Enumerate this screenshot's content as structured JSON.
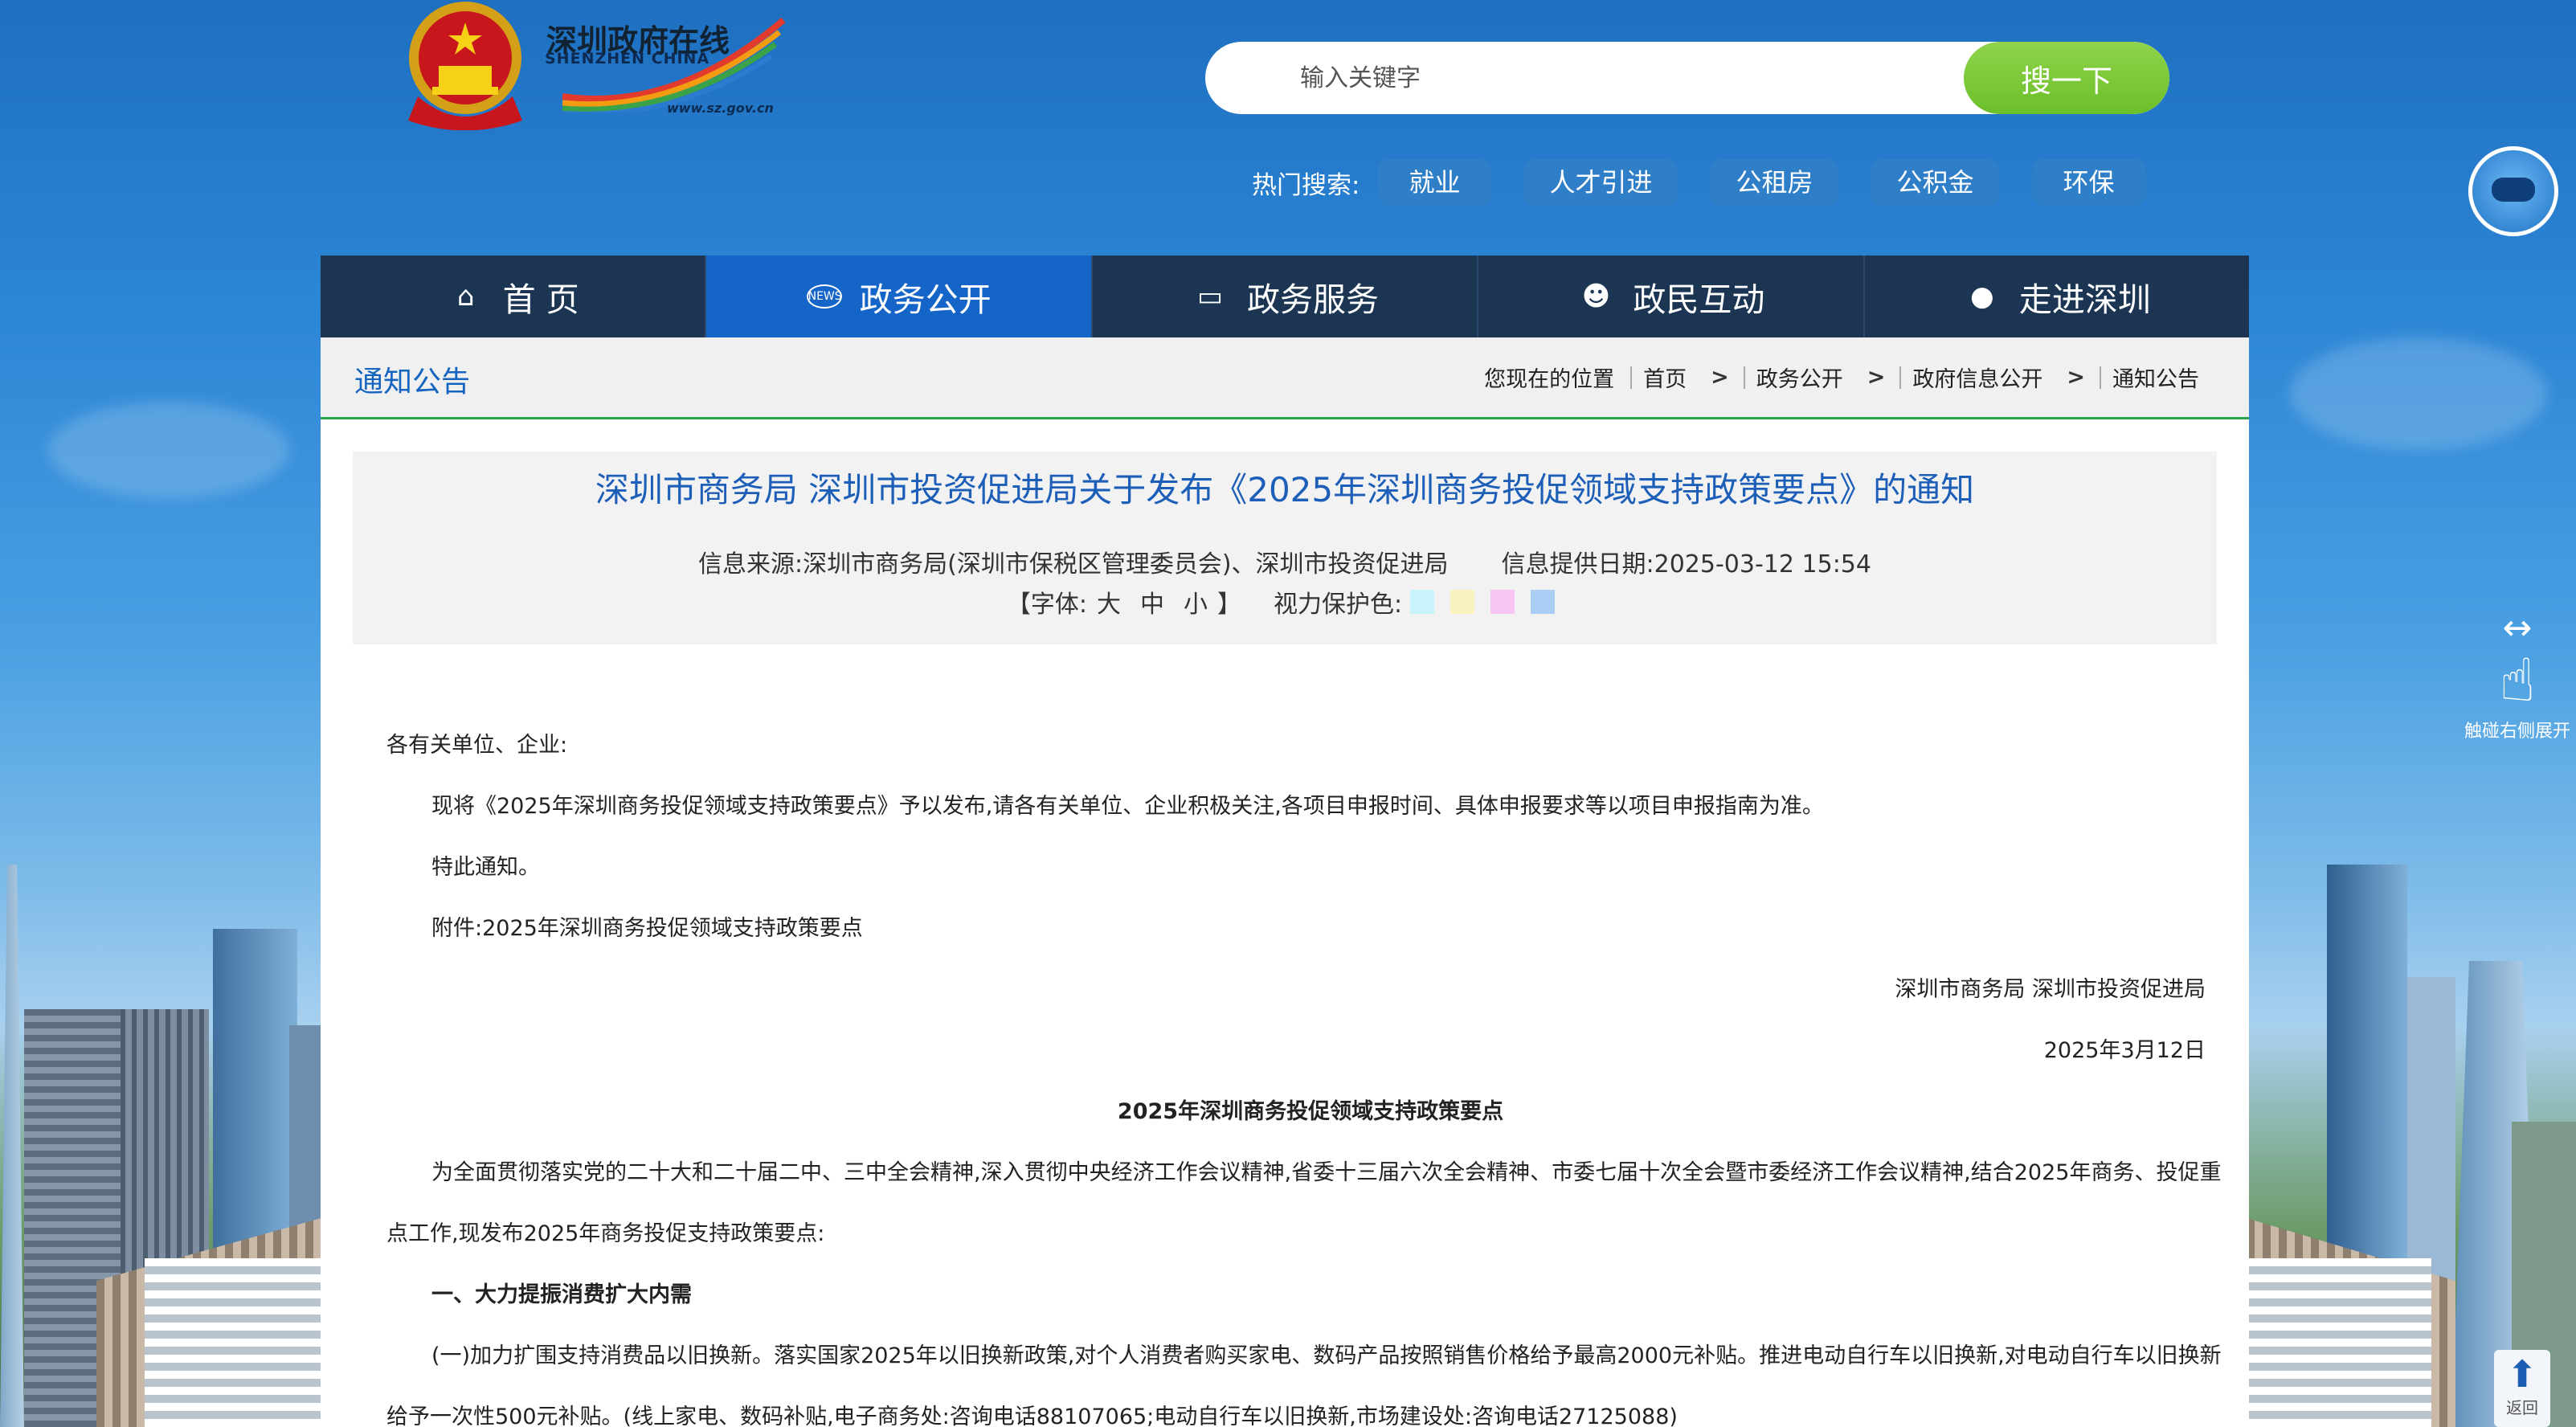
{
  "logo": {
    "cn": "深圳政府在线",
    "en": "SHENZHEN CHINA",
    "url": "www.sz.gov.cn"
  },
  "search": {
    "placeholder": "输入关键字",
    "button": "搜一下"
  },
  "hot_search": {
    "label": "热门搜索:",
    "tags": [
      "就业",
      "人才引进",
      "公租房",
      "公积金",
      "环保"
    ]
  },
  "nav": {
    "items": [
      {
        "label": "首 页",
        "icon": "home-icon"
      },
      {
        "label": "政务公开",
        "icon": "news-icon",
        "active": true
      },
      {
        "label": "政务服务",
        "icon": "monitor-icon"
      },
      {
        "label": "政民互动",
        "icon": "people-icon"
      },
      {
        "label": "走进深圳",
        "icon": "chat-icon"
      }
    ]
  },
  "section": {
    "title": "通知公告"
  },
  "breadcrumb": {
    "label": "您现在的位置",
    "items": [
      "首页",
      "政务公开",
      "政府信息公开",
      "通知公告"
    ]
  },
  "article": {
    "title": "深圳市商务局 深圳市投资促进局关于发布《2025年深圳商务投促领域支持政策要点》的通知",
    "source": "信息来源:深圳市商务局(深圳市保税区管理委员会)、深圳市投资促进局",
    "date": "信息提供日期:2025-03-12 15:54",
    "font_label": "【字体:",
    "font_sizes": [
      "大",
      "中",
      "小"
    ],
    "font_close": "】",
    "eye_label": "视力保护色:",
    "eye_colors": [
      "#c8f3fb",
      "#faf3c0",
      "#f8c6f2",
      "#a9cdf3"
    ],
    "paragraphs": [
      {
        "style": "plain",
        "text": "各有关单位、企业:"
      },
      {
        "style": "indent",
        "text": "现将《2025年深圳商务投促领域支持政策要点》予以发布,请各有关单位、企业积极关注,各项目申报时间、具体申报要求等以项目申报指南为准。"
      },
      {
        "style": "indent",
        "text": "特此通知。"
      },
      {
        "style": "indent",
        "text": "附件:2025年深圳商务投促领域支持政策要点"
      },
      {
        "style": "right",
        "text": "深圳市商务局 深圳市投资促进局"
      },
      {
        "style": "right",
        "text": "2025年3月12日"
      },
      {
        "style": "center",
        "text": "2025年深圳商务投促领域支持政策要点"
      },
      {
        "style": "indent",
        "text": "为全面贯彻落实党的二十大和二十届二中、三中全会精神,深入贯彻中央经济工作会议精神,省委十三届六次全会精神、市委七届十次全会暨市委经济工作会议精神,结合2025年商务、投促重点工作,现发布2025年商务投促支持政策要点:"
      },
      {
        "style": "bold",
        "text": "一、大力提振消费扩大内需"
      },
      {
        "style": "indent",
        "text": "(一)加力扩围支持消费品以旧换新。落实国家2025年以旧换新政策,对个人消费者购买家电、数码产品按照销售价格给予最高2000元补贴。推进电动自行车以旧换新,对电动自行车以旧换新给予一次性500元补贴。(线上家电、数码补贴,电子商务处:咨询电话88107065;电动自行车以旧换新,市场建设处:咨询电话27125088)"
      }
    ]
  },
  "side": {
    "hint": "触碰右侧展开",
    "back_top": "返回"
  }
}
